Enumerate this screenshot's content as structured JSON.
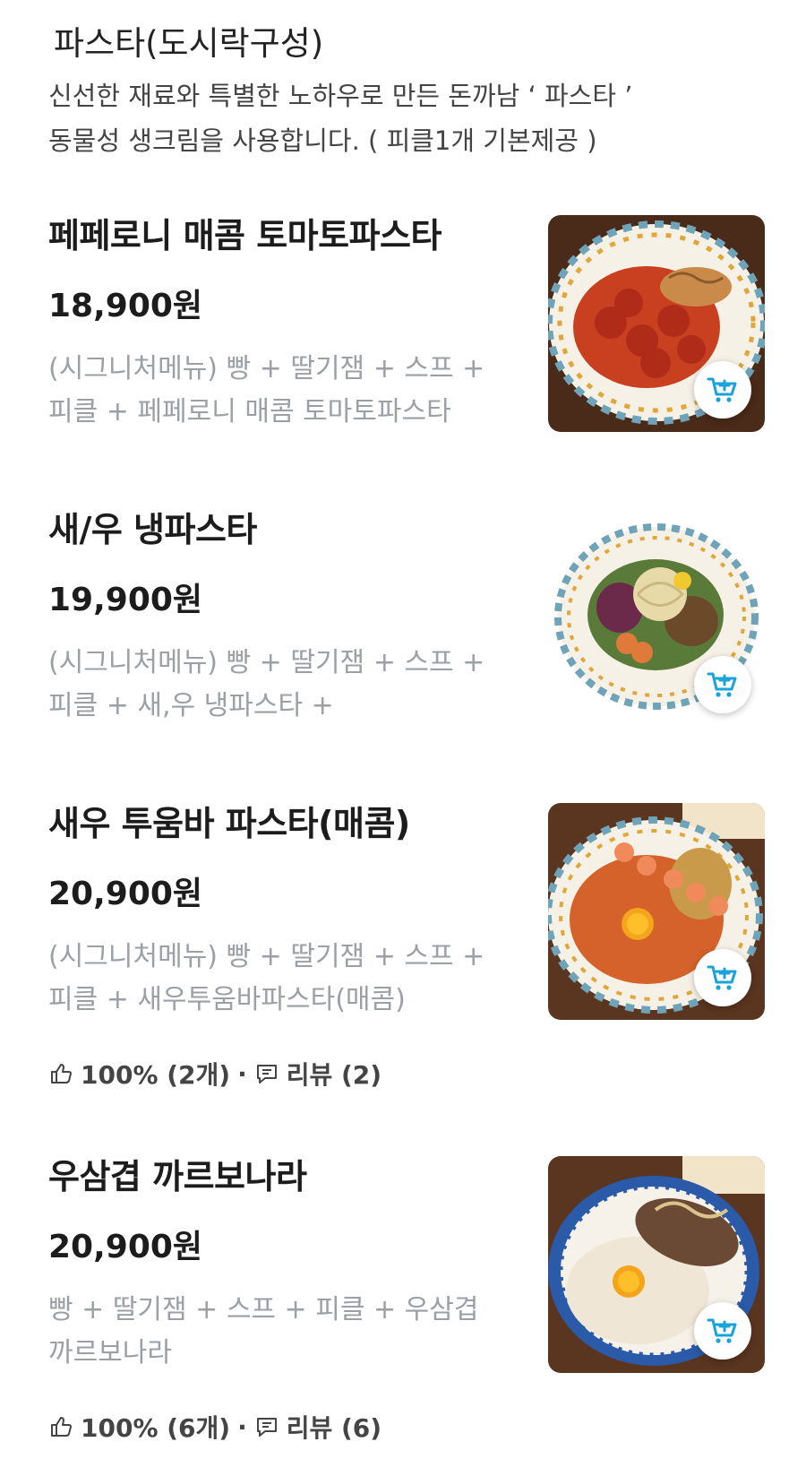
{
  "section": {
    "title": "파스타(도시락구성)",
    "desc_line1": "신선한 재료와 특별한 노하우로 만든 돈까남 ‘ 파스타 ’",
    "desc_line2": "동물성 생크림을 사용합니다. ( 피클1개 기본제공 )"
  },
  "items": [
    {
      "name": "페페로니 매콤 토마토파스타",
      "price": "18,900원",
      "desc_line1": "(시그니처메뉴) 빵 + 딸기잼 + 스프 +",
      "desc_line2": "피클 + 페페로니 매콤 토마토파스타",
      "cart_icon": "cart-plus-icon"
    },
    {
      "name": "새/우 냉파스타",
      "price": "19,900원",
      "desc_line1": "(시그니처메뉴) 빵 + 딸기잼 + 스프 +",
      "desc_line2": "피클 + 새,우 냉파스타 +",
      "cart_icon": "cart-plus-icon"
    },
    {
      "name": "새우 투움바 파스타(매콤)",
      "price": "20,900원",
      "desc_line1": "(시그니처메뉴) 빵 + 딸기잼 + 스프 +",
      "desc_line2": "피클 + 새우투움바파스타(매콤)",
      "review_like": "100% (2개)",
      "review_sep": "·",
      "review_count": "리뷰 (2)",
      "cart_icon": "cart-plus-icon"
    },
    {
      "name": "우삼겹 까르보나라",
      "price": "20,900원",
      "desc_line1": "빵 + 딸기잼 + 스프 + 피클 + 우삼겹",
      "desc_line2": "까르보나라",
      "review_like": "100% (6개)",
      "review_sep": "·",
      "review_count": "리뷰 (6)",
      "cart_icon": "cart-plus-icon"
    }
  ],
  "colors": {
    "accent": "#1aa3d9",
    "desc_gray": "#9aa0a6",
    "text_dark": "#1c1c1c"
  }
}
